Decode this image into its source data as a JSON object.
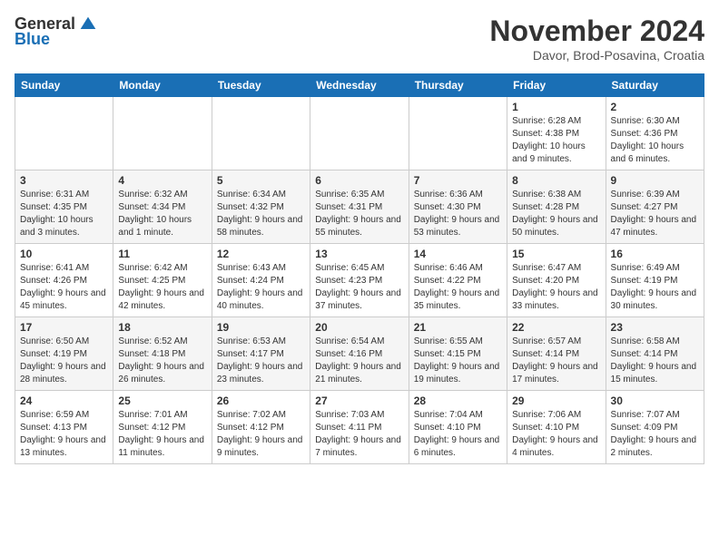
{
  "header": {
    "logo_general": "General",
    "logo_blue": "Blue",
    "month_title": "November 2024",
    "location": "Davor, Brod-Posavina, Croatia"
  },
  "days_of_week": [
    "Sunday",
    "Monday",
    "Tuesday",
    "Wednesday",
    "Thursday",
    "Friday",
    "Saturday"
  ],
  "weeks": [
    [
      {
        "day": "",
        "info": ""
      },
      {
        "day": "",
        "info": ""
      },
      {
        "day": "",
        "info": ""
      },
      {
        "day": "",
        "info": ""
      },
      {
        "day": "",
        "info": ""
      },
      {
        "day": "1",
        "info": "Sunrise: 6:28 AM\nSunset: 4:38 PM\nDaylight: 10 hours and 9 minutes."
      },
      {
        "day": "2",
        "info": "Sunrise: 6:30 AM\nSunset: 4:36 PM\nDaylight: 10 hours and 6 minutes."
      }
    ],
    [
      {
        "day": "3",
        "info": "Sunrise: 6:31 AM\nSunset: 4:35 PM\nDaylight: 10 hours and 3 minutes."
      },
      {
        "day": "4",
        "info": "Sunrise: 6:32 AM\nSunset: 4:34 PM\nDaylight: 10 hours and 1 minute."
      },
      {
        "day": "5",
        "info": "Sunrise: 6:34 AM\nSunset: 4:32 PM\nDaylight: 9 hours and 58 minutes."
      },
      {
        "day": "6",
        "info": "Sunrise: 6:35 AM\nSunset: 4:31 PM\nDaylight: 9 hours and 55 minutes."
      },
      {
        "day": "7",
        "info": "Sunrise: 6:36 AM\nSunset: 4:30 PM\nDaylight: 9 hours and 53 minutes."
      },
      {
        "day": "8",
        "info": "Sunrise: 6:38 AM\nSunset: 4:28 PM\nDaylight: 9 hours and 50 minutes."
      },
      {
        "day": "9",
        "info": "Sunrise: 6:39 AM\nSunset: 4:27 PM\nDaylight: 9 hours and 47 minutes."
      }
    ],
    [
      {
        "day": "10",
        "info": "Sunrise: 6:41 AM\nSunset: 4:26 PM\nDaylight: 9 hours and 45 minutes."
      },
      {
        "day": "11",
        "info": "Sunrise: 6:42 AM\nSunset: 4:25 PM\nDaylight: 9 hours and 42 minutes."
      },
      {
        "day": "12",
        "info": "Sunrise: 6:43 AM\nSunset: 4:24 PM\nDaylight: 9 hours and 40 minutes."
      },
      {
        "day": "13",
        "info": "Sunrise: 6:45 AM\nSunset: 4:23 PM\nDaylight: 9 hours and 37 minutes."
      },
      {
        "day": "14",
        "info": "Sunrise: 6:46 AM\nSunset: 4:22 PM\nDaylight: 9 hours and 35 minutes."
      },
      {
        "day": "15",
        "info": "Sunrise: 6:47 AM\nSunset: 4:20 PM\nDaylight: 9 hours and 33 minutes."
      },
      {
        "day": "16",
        "info": "Sunrise: 6:49 AM\nSunset: 4:19 PM\nDaylight: 9 hours and 30 minutes."
      }
    ],
    [
      {
        "day": "17",
        "info": "Sunrise: 6:50 AM\nSunset: 4:19 PM\nDaylight: 9 hours and 28 minutes."
      },
      {
        "day": "18",
        "info": "Sunrise: 6:52 AM\nSunset: 4:18 PM\nDaylight: 9 hours and 26 minutes."
      },
      {
        "day": "19",
        "info": "Sunrise: 6:53 AM\nSunset: 4:17 PM\nDaylight: 9 hours and 23 minutes."
      },
      {
        "day": "20",
        "info": "Sunrise: 6:54 AM\nSunset: 4:16 PM\nDaylight: 9 hours and 21 minutes."
      },
      {
        "day": "21",
        "info": "Sunrise: 6:55 AM\nSunset: 4:15 PM\nDaylight: 9 hours and 19 minutes."
      },
      {
        "day": "22",
        "info": "Sunrise: 6:57 AM\nSunset: 4:14 PM\nDaylight: 9 hours and 17 minutes."
      },
      {
        "day": "23",
        "info": "Sunrise: 6:58 AM\nSunset: 4:14 PM\nDaylight: 9 hours and 15 minutes."
      }
    ],
    [
      {
        "day": "24",
        "info": "Sunrise: 6:59 AM\nSunset: 4:13 PM\nDaylight: 9 hours and 13 minutes."
      },
      {
        "day": "25",
        "info": "Sunrise: 7:01 AM\nSunset: 4:12 PM\nDaylight: 9 hours and 11 minutes."
      },
      {
        "day": "26",
        "info": "Sunrise: 7:02 AM\nSunset: 4:12 PM\nDaylight: 9 hours and 9 minutes."
      },
      {
        "day": "27",
        "info": "Sunrise: 7:03 AM\nSunset: 4:11 PM\nDaylight: 9 hours and 7 minutes."
      },
      {
        "day": "28",
        "info": "Sunrise: 7:04 AM\nSunset: 4:10 PM\nDaylight: 9 hours and 6 minutes."
      },
      {
        "day": "29",
        "info": "Sunrise: 7:06 AM\nSunset: 4:10 PM\nDaylight: 9 hours and 4 minutes."
      },
      {
        "day": "30",
        "info": "Sunrise: 7:07 AM\nSunset: 4:09 PM\nDaylight: 9 hours and 2 minutes."
      }
    ]
  ]
}
